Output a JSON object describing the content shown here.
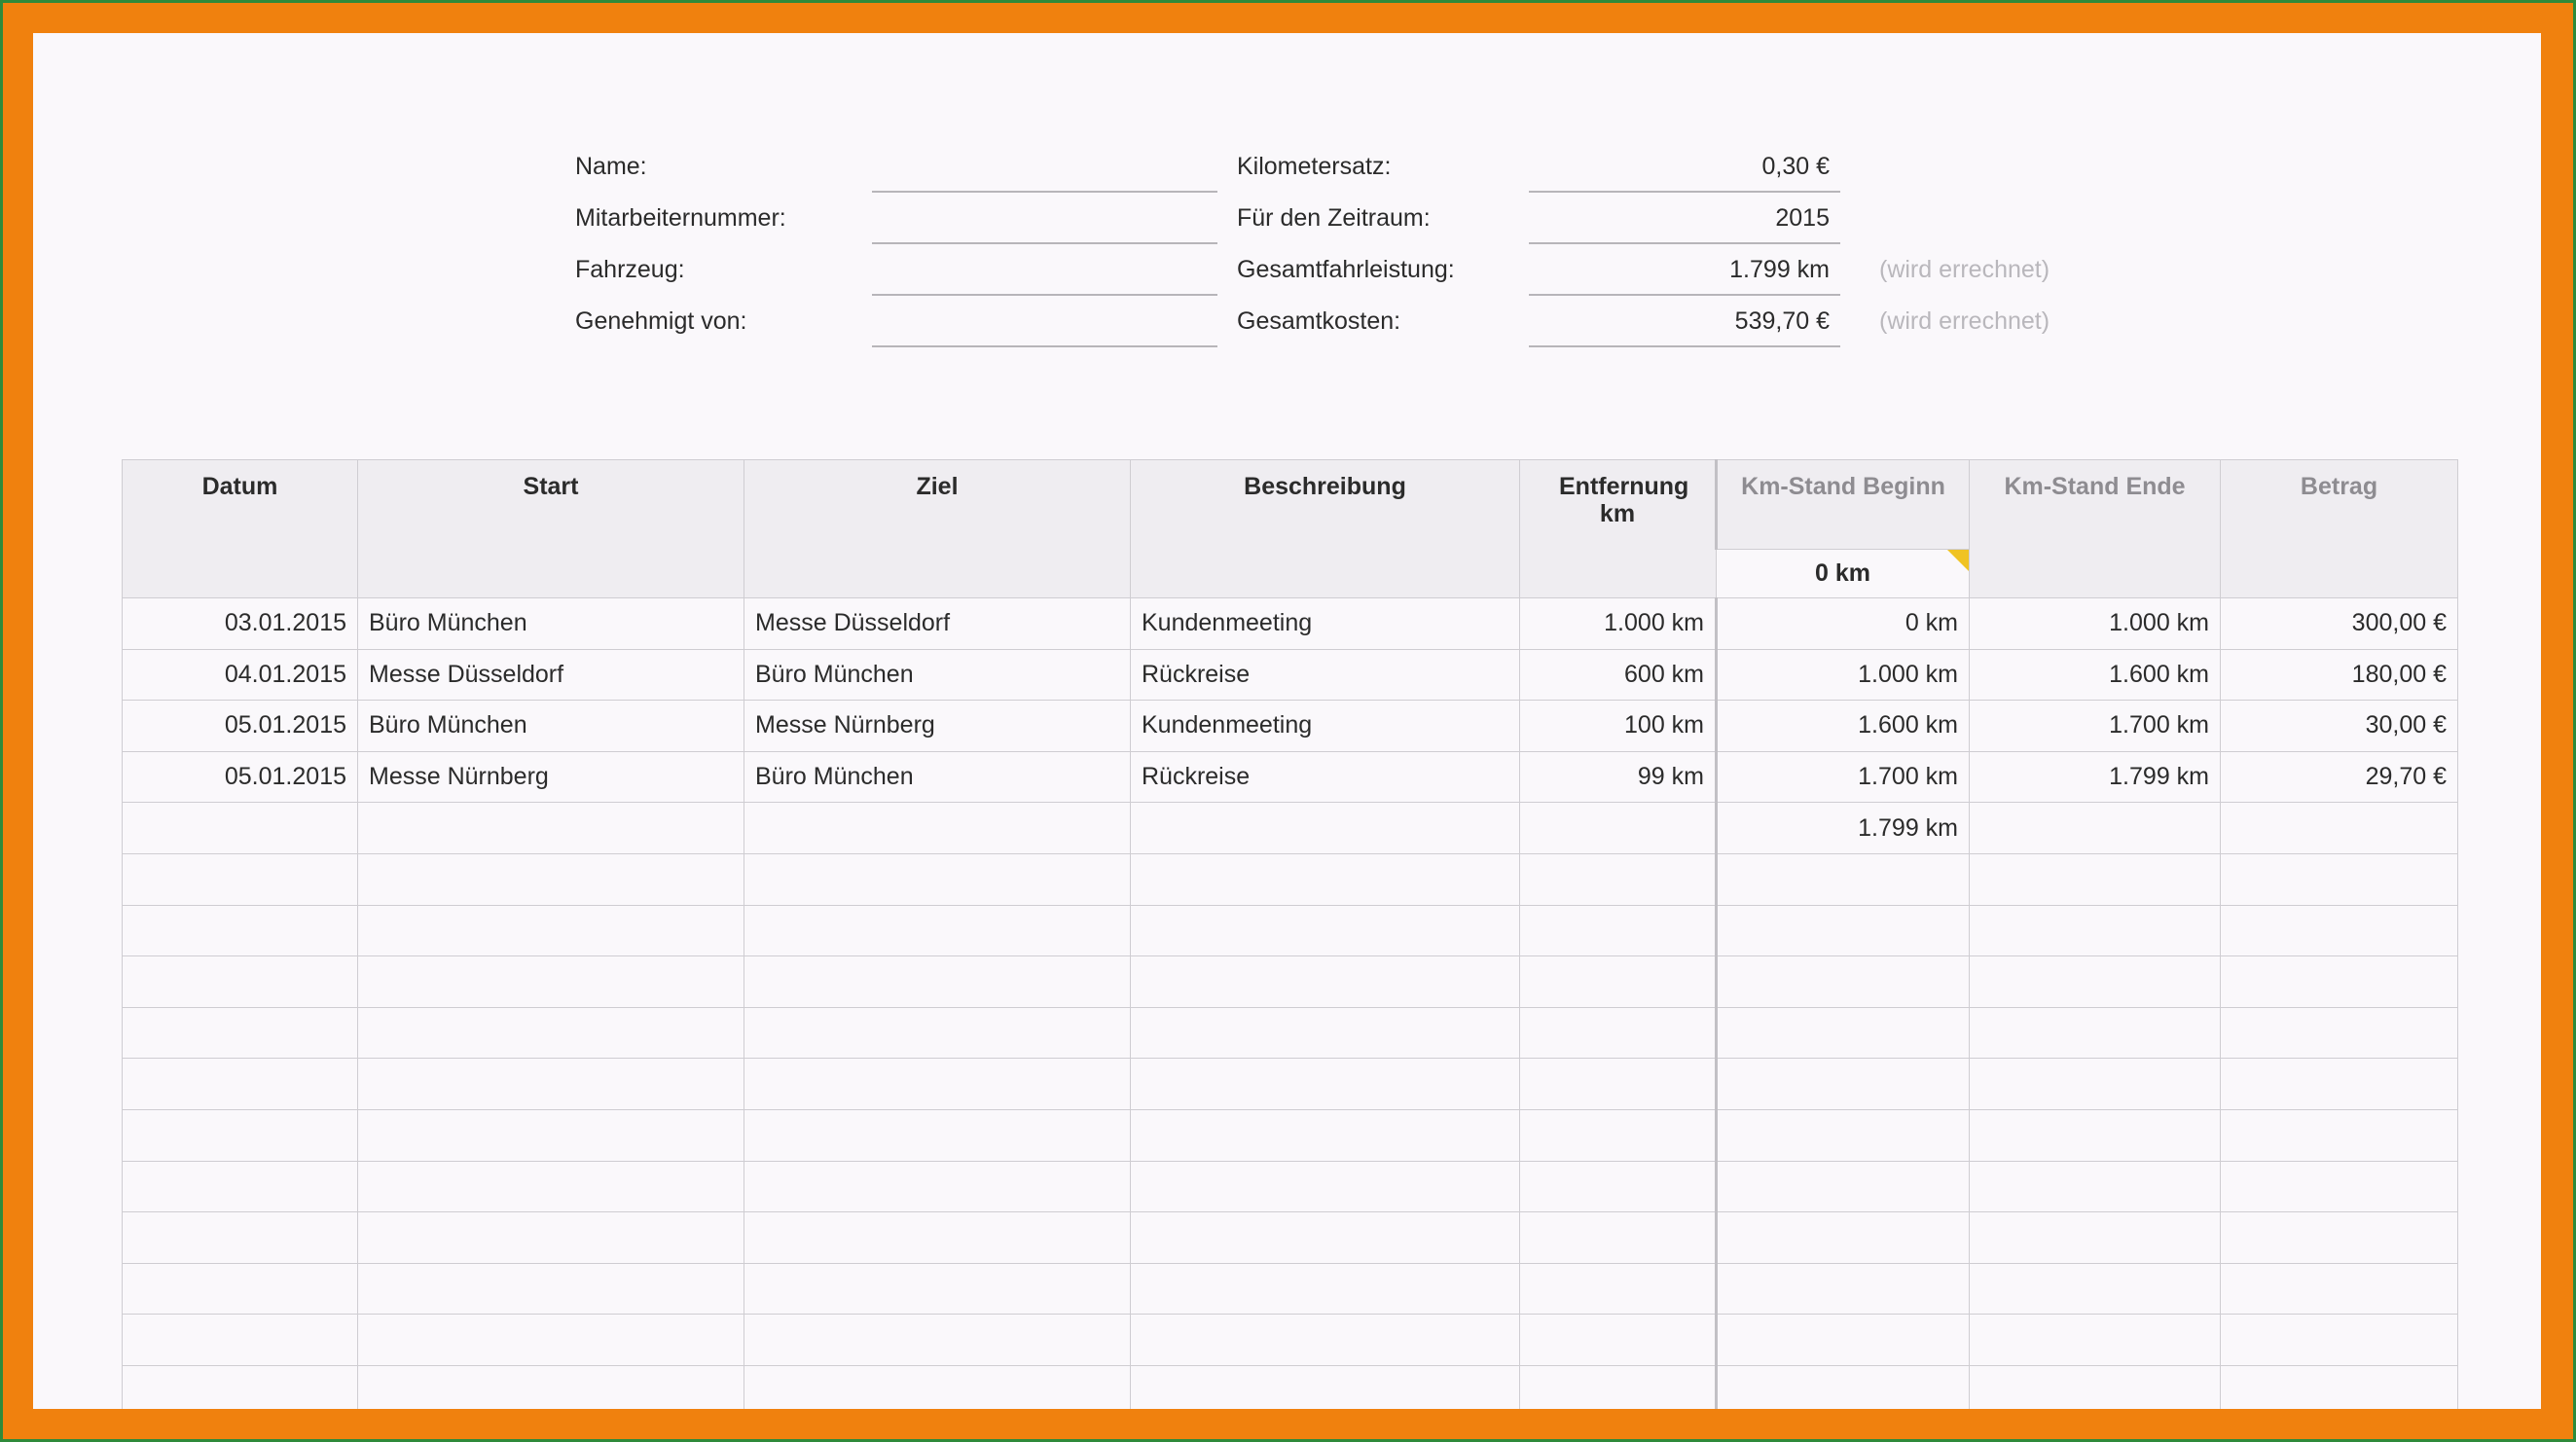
{
  "form_left": [
    {
      "label": "Name:",
      "value": ""
    },
    {
      "label": "Mitarbeiternummer:",
      "value": ""
    },
    {
      "label": "Fahrzeug:",
      "value": ""
    },
    {
      "label": "Genehmigt von:",
      "value": ""
    }
  ],
  "form_right": [
    {
      "label": "Kilometersatz:",
      "value": "0,30 €",
      "note": ""
    },
    {
      "label": "Für den Zeitraum:",
      "value": "2015",
      "note": ""
    },
    {
      "label": "Gesamtfahrleistung:",
      "value": "1.799 km",
      "note": "(wird errechnet)"
    },
    {
      "label": "Gesamtkosten:",
      "value": "539,70 €",
      "note": "(wird errechnet)"
    }
  ],
  "table": {
    "headers": {
      "datum": "Datum",
      "start": "Start",
      "ziel": "Ziel",
      "beschreibung": "Beschreibung",
      "entfernung": "Entfernung km",
      "km_beginn": "Km-Stand Beginn",
      "km_ende": "Km-Stand Ende",
      "betrag": "Betrag"
    },
    "start_km": "0 km",
    "rows": [
      {
        "datum": "03.01.2015",
        "start": "Büro München",
        "ziel": "Messe Düsseldorf",
        "beschreibung": "Kundenmeeting",
        "entfernung": "1.000 km",
        "km_beginn": "0 km",
        "km_ende": "1.000 km",
        "betrag": "300,00 €"
      },
      {
        "datum": "04.01.2015",
        "start": "Messe Düsseldorf",
        "ziel": "Büro München",
        "beschreibung": "Rückreise",
        "entfernung": "600 km",
        "km_beginn": "1.000 km",
        "km_ende": "1.600 km",
        "betrag": "180,00 €"
      },
      {
        "datum": "05.01.2015",
        "start": "Büro München",
        "ziel": "Messe Nürnberg",
        "beschreibung": "Kundenmeeting",
        "entfernung": "100 km",
        "km_beginn": "1.600 km",
        "km_ende": "1.700 km",
        "betrag": "30,00 €"
      },
      {
        "datum": "05.01.2015",
        "start": "Messe Nürnberg",
        "ziel": "Büro München",
        "beschreibung": "Rückreise",
        "entfernung": "99 km",
        "km_beginn": "1.700 km",
        "km_ende": "1.799 km",
        "betrag": "29,70 €"
      },
      {
        "datum": "",
        "start": "",
        "ziel": "",
        "beschreibung": "",
        "entfernung": "",
        "km_beginn": "1.799 km",
        "km_ende": "",
        "betrag": ""
      },
      {
        "datum": "",
        "start": "",
        "ziel": "",
        "beschreibung": "",
        "entfernung": "",
        "km_beginn": "",
        "km_ende": "",
        "betrag": ""
      },
      {
        "datum": "",
        "start": "",
        "ziel": "",
        "beschreibung": "",
        "entfernung": "",
        "km_beginn": "",
        "km_ende": "",
        "betrag": ""
      },
      {
        "datum": "",
        "start": "",
        "ziel": "",
        "beschreibung": "",
        "entfernung": "",
        "km_beginn": "",
        "km_ende": "",
        "betrag": ""
      },
      {
        "datum": "",
        "start": "",
        "ziel": "",
        "beschreibung": "",
        "entfernung": "",
        "km_beginn": "",
        "km_ende": "",
        "betrag": ""
      },
      {
        "datum": "",
        "start": "",
        "ziel": "",
        "beschreibung": "",
        "entfernung": "",
        "km_beginn": "",
        "km_ende": "",
        "betrag": ""
      },
      {
        "datum": "",
        "start": "",
        "ziel": "",
        "beschreibung": "",
        "entfernung": "",
        "km_beginn": "",
        "km_ende": "",
        "betrag": ""
      },
      {
        "datum": "",
        "start": "",
        "ziel": "",
        "beschreibung": "",
        "entfernung": "",
        "km_beginn": "",
        "km_ende": "",
        "betrag": ""
      },
      {
        "datum": "",
        "start": "",
        "ziel": "",
        "beschreibung": "",
        "entfernung": "",
        "km_beginn": "",
        "km_ende": "",
        "betrag": ""
      },
      {
        "datum": "",
        "start": "",
        "ziel": "",
        "beschreibung": "",
        "entfernung": "",
        "km_beginn": "",
        "km_ende": "",
        "betrag": ""
      },
      {
        "datum": "",
        "start": "",
        "ziel": "",
        "beschreibung": "",
        "entfernung": "",
        "km_beginn": "",
        "km_ende": "",
        "betrag": ""
      },
      {
        "datum": "",
        "start": "",
        "ziel": "",
        "beschreibung": "",
        "entfernung": "",
        "km_beginn": "",
        "km_ende": "",
        "betrag": ""
      }
    ]
  },
  "colors": {
    "frame": "#f0810e",
    "sheet": "#faf8fb",
    "header_bg": "#efedf1",
    "corner_mark": "#f0c323",
    "muted_text": "#b9b7bc"
  }
}
